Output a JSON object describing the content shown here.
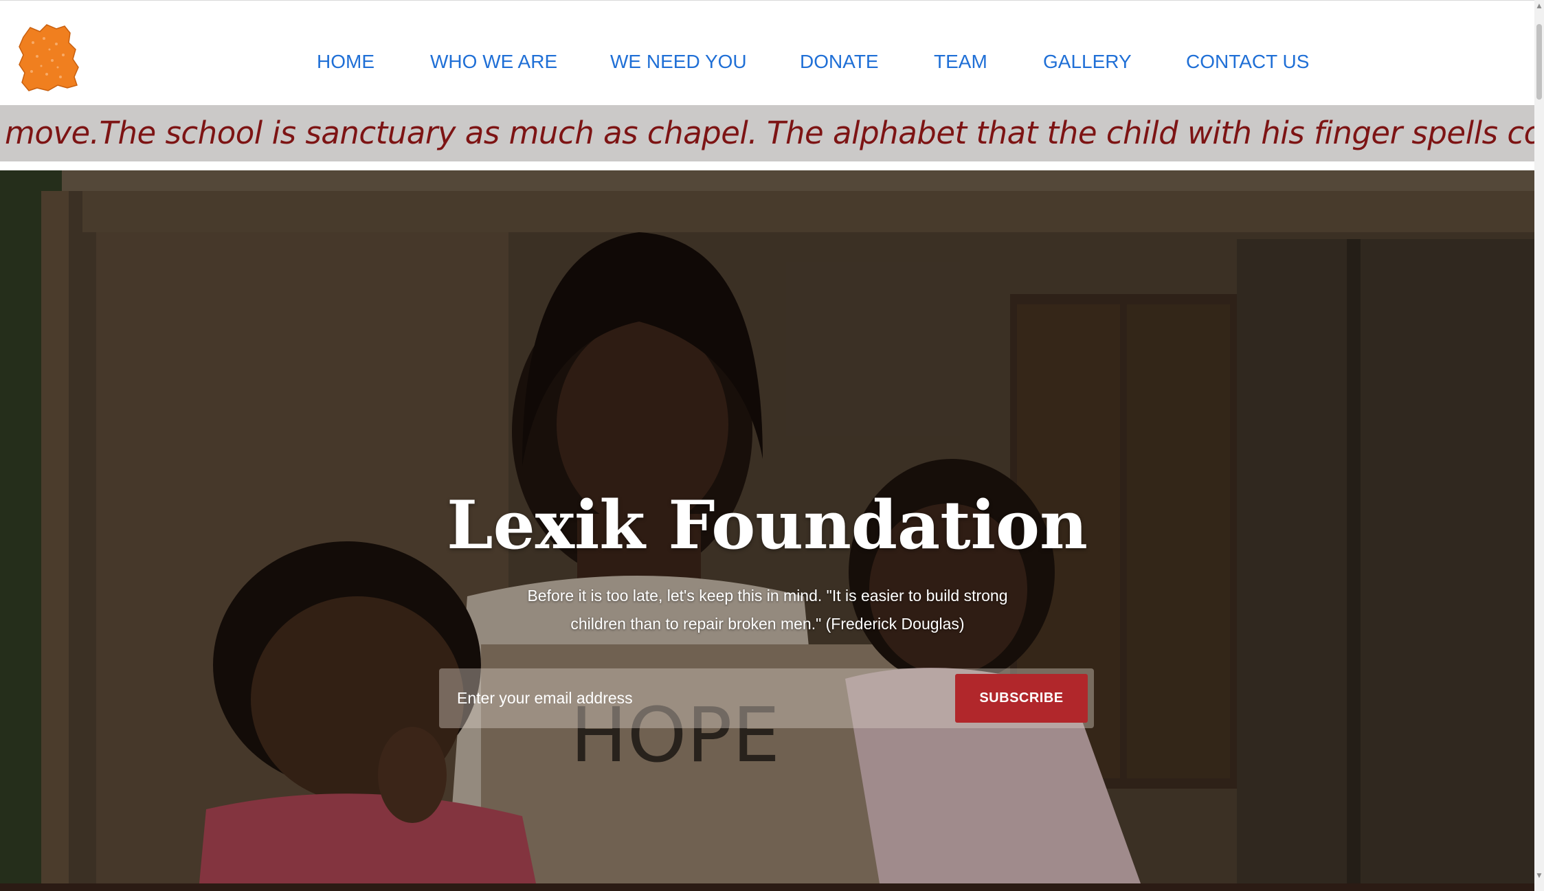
{
  "brand": {
    "logo_icon": "map-logo-icon",
    "logo_color": "#f07f1f"
  },
  "nav": {
    "items": [
      {
        "label": "HOME"
      },
      {
        "label": "WHO WE ARE"
      },
      {
        "label": "WE NEED YOU"
      },
      {
        "label": "DONATE"
      },
      {
        "label": "TEAM"
      },
      {
        "label": "GALLERY"
      },
      {
        "label": "CONTACT US"
      }
    ],
    "color": "#1f6fd6"
  },
  "marquee": {
    "text": "move.The school is sanctuary as much as chapel. The alphabet that the child with his finger spells contains virtu",
    "color": "#7d1414",
    "background": "#cbc9c8"
  },
  "hero": {
    "title": "Lexik Foundation",
    "subtitle": "Before it is too late, let's keep this in mind. \"It is easier to build strong children than to repair broken men.\" (Frederick Douglas)",
    "sign_text": "HOPE",
    "email_placeholder": "Enter your email address",
    "subscribe_label": "SUBSCRIBE",
    "button_color": "#b1272b"
  }
}
